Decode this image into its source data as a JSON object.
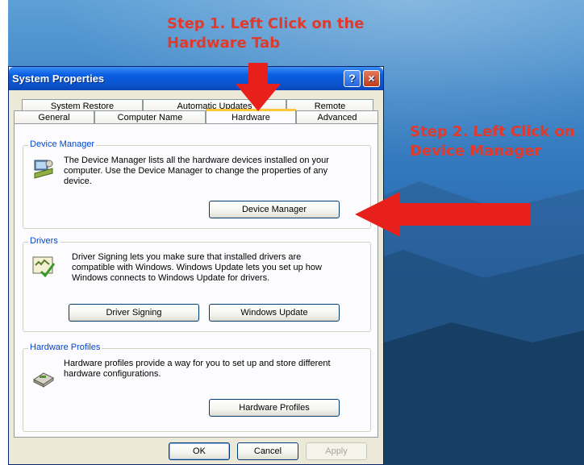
{
  "annotations": {
    "step1": "Step 1. Left Click on the Hardware Tab",
    "step2": "Step 2. Left Click on Device Manager"
  },
  "window": {
    "title": "System Properties",
    "help_icon": "?",
    "close_icon": "×"
  },
  "tabs": {
    "row_back": [
      "System Restore",
      "Automatic Updates",
      "Remote"
    ],
    "row_front": [
      "General",
      "Computer Name",
      "Hardware",
      "Advanced"
    ],
    "active": "Hardware"
  },
  "device_manager": {
    "label": "Device Manager",
    "text": "The Device Manager lists all the hardware devices installed on your computer. Use the Device Manager to change the properties of any device.",
    "button": "Device Manager",
    "icon": "device-manager-icon"
  },
  "drivers": {
    "label": "Drivers",
    "text": "Driver Signing lets you make sure that installed drivers are compatible with Windows. Windows Update lets you set up how Windows connects to Windows Update for drivers.",
    "button_signing": "Driver Signing",
    "button_update": "Windows Update",
    "icon": "driver-signing-icon"
  },
  "hardware_profiles": {
    "label": "Hardware Profiles",
    "text": "Hardware profiles provide a way for you to set up and store different hardware configurations.",
    "button": "Hardware Profiles",
    "icon": "hardware-profiles-icon"
  },
  "footer": {
    "ok": "OK",
    "cancel": "Cancel",
    "apply": "Apply"
  },
  "colors": {
    "annotation": "#e03a2d",
    "titlebar": "#0a5ee3",
    "group_label": "#0046d5",
    "active_tab_accent": "#ffc83c"
  }
}
